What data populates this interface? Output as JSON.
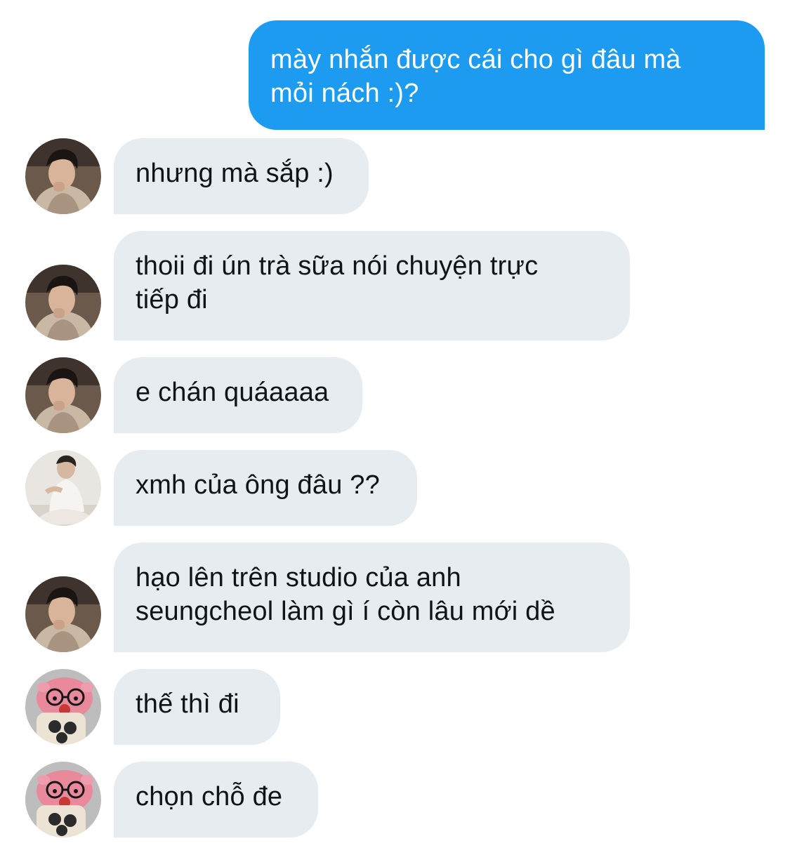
{
  "colors": {
    "sent_bubble": "#1d9bf0",
    "received_bubble": "#e7ecf0",
    "received_text": "#0f1419",
    "sent_text": "#ffffff",
    "background": "#ffffff"
  },
  "messages": [
    {
      "direction": "sent",
      "lines": [
        "mày nhắn được cái cho gì đâu mà",
        "mỏi nách :)?"
      ]
    },
    {
      "direction": "received",
      "avatar": "avatar-dark-hoodie",
      "lines": [
        "nhưng mà sắp :)"
      ]
    },
    {
      "direction": "received",
      "avatar": "avatar-dark-hoodie",
      "lines": [
        "thoii đi ún trà sữa nói chuyện trực",
        "tiếp đi"
      ]
    },
    {
      "direction": "received",
      "avatar": "avatar-dark-hoodie",
      "lines": [
        "e chán quáaaaa"
      ]
    },
    {
      "direction": "received",
      "avatar": "avatar-white-shirt",
      "lines": [
        "xmh của ông đâu ??"
      ]
    },
    {
      "direction": "received",
      "avatar": "avatar-dark-hoodie",
      "lines": [
        "hạo lên trên studio của anh",
        "seungcheol làm gì í còn lâu mới dề"
      ]
    },
    {
      "direction": "received",
      "avatar": "avatar-pink-plush",
      "lines": [
        "thế thì đi"
      ]
    },
    {
      "direction": "received",
      "avatar": "avatar-pink-plush",
      "lines": [
        "chọn chỗ đe"
      ]
    }
  ]
}
